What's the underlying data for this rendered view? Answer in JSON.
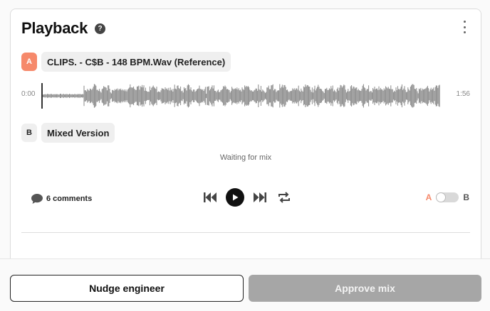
{
  "header": {
    "title": "Playback",
    "help_icon": "question-circle-icon"
  },
  "track_a": {
    "badge": "A",
    "name": "CLIPS. - C$B - 148 BPM.Wav (Reference)",
    "time_start": "0:00",
    "time_end": "1:56"
  },
  "track_b": {
    "badge": "B",
    "name": "Mixed Version",
    "status": "Waiting for mix"
  },
  "controls": {
    "comments_label": "6 comments",
    "ab_a": "A",
    "ab_b": "B"
  },
  "footer": {
    "nudge_label": "Nudge engineer",
    "approve_label": "Approve mix"
  },
  "colors": {
    "accent": "#f6896b",
    "disabled_button": "#a6a6a6"
  }
}
